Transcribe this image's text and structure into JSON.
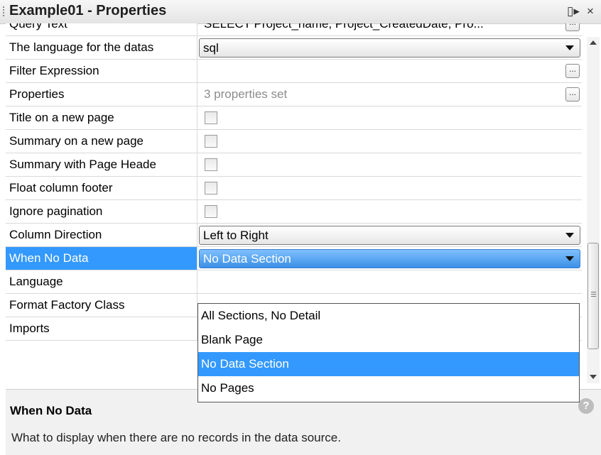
{
  "window": {
    "title": "Example01 - Properties",
    "pin_glyph": "▯▸",
    "close_glyph": "×"
  },
  "properties": [
    {
      "name": "Query Text",
      "type": "text",
      "value": "SELECT Project_name, Project_CreatedDate, Pro...",
      "ellipsis": "..."
    },
    {
      "name": "The language for the datas",
      "type": "combo",
      "value": "sql"
    },
    {
      "name": "Filter Expression",
      "type": "text",
      "value": "",
      "ellipsis": "..."
    },
    {
      "name": "Properties",
      "type": "text",
      "value": "3 properties set",
      "ellipsis": "..."
    },
    {
      "name": "Title on a new page",
      "type": "checkbox",
      "checked": false
    },
    {
      "name": "Summary on a new page",
      "type": "checkbox",
      "checked": false
    },
    {
      "name": "Summary with Page Heade",
      "type": "checkbox",
      "checked": false
    },
    {
      "name": "Float column footer",
      "type": "checkbox",
      "checked": false
    },
    {
      "name": "Ignore pagination",
      "type": "checkbox",
      "checked": false
    },
    {
      "name": "Column Direction",
      "type": "combo",
      "value": "Left to Right"
    },
    {
      "name": "When No Data",
      "type": "combo",
      "value": "No Data Section",
      "selected": true
    },
    {
      "name": "Language",
      "type": "text",
      "value": ""
    },
    {
      "name": "Format Factory Class",
      "type": "text",
      "value": ""
    },
    {
      "name": "Imports",
      "type": "text",
      "value": ""
    }
  ],
  "dropdown": {
    "options": [
      "All Sections, No Detail",
      "Blank Page",
      "No Data Section",
      "No Pages"
    ],
    "highlighted": "No Data Section"
  },
  "description": {
    "title": "When No Data",
    "text": "What to display when there are no records in the data source.",
    "help_glyph": "?"
  },
  "colors": {
    "selection": "#3399ff",
    "grid_line": "#d9d9d9",
    "panel_bg": "#f1f1f1"
  }
}
